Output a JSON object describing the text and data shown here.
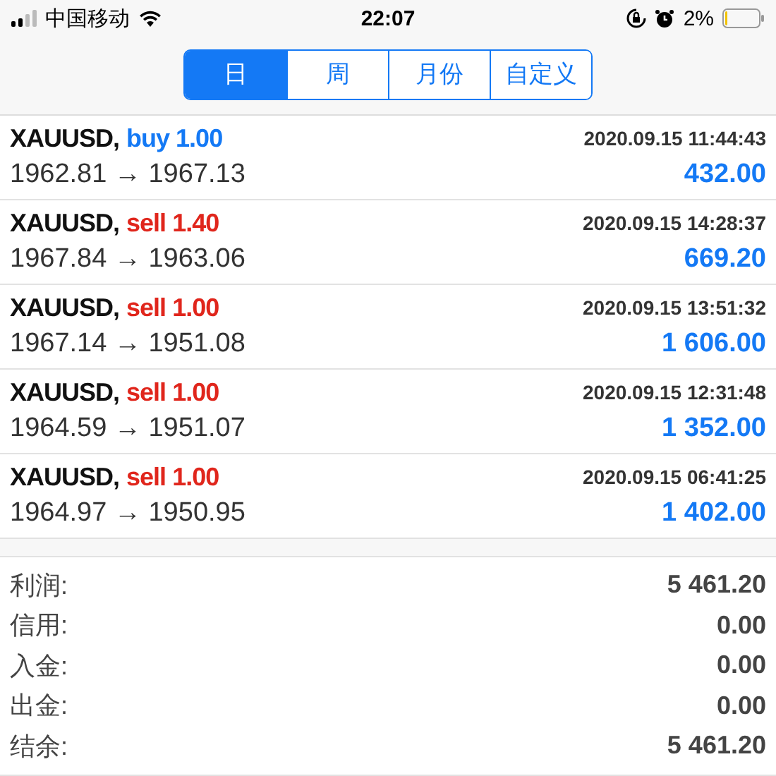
{
  "status_bar": {
    "carrier": "中国移动",
    "time": "22:07",
    "battery_text": "2%"
  },
  "tabs": [
    {
      "label": "日",
      "selected": true
    },
    {
      "label": "周",
      "selected": false
    },
    {
      "label": "月份",
      "selected": false
    },
    {
      "label": "自定义",
      "selected": false
    }
  ],
  "trades": [
    {
      "symbol": "XAUUSD,",
      "side": "buy",
      "volume": "1.00",
      "prices": "1962.81 → 1967.13",
      "time": "2020.09.15 11:44:43",
      "profit": "432.00"
    },
    {
      "symbol": "XAUUSD,",
      "side": "sell",
      "volume": "1.40",
      "prices": "1967.84 → 1963.06",
      "time": "2020.09.15 14:28:37",
      "profit": "669.20"
    },
    {
      "symbol": "XAUUSD,",
      "side": "sell",
      "volume": "1.00",
      "prices": "1967.14 → 1951.08",
      "time": "2020.09.15 13:51:32",
      "profit": "1 606.00"
    },
    {
      "symbol": "XAUUSD,",
      "side": "sell",
      "volume": "1.00",
      "prices": "1964.59 → 1951.07",
      "time": "2020.09.15 12:31:48",
      "profit": "1 352.00"
    },
    {
      "symbol": "XAUUSD,",
      "side": "sell",
      "volume": "1.00",
      "prices": "1964.97 → 1950.95",
      "time": "2020.09.15 06:41:25",
      "profit": "1 402.00"
    }
  ],
  "summary": [
    {
      "label": "利润:",
      "value": "5 461.20"
    },
    {
      "label": "信用:",
      "value": "0.00"
    },
    {
      "label": "入金:",
      "value": "0.00"
    },
    {
      "label": "出金:",
      "value": "0.00"
    },
    {
      "label": "结余:",
      "value": "5 461.20"
    }
  ]
}
